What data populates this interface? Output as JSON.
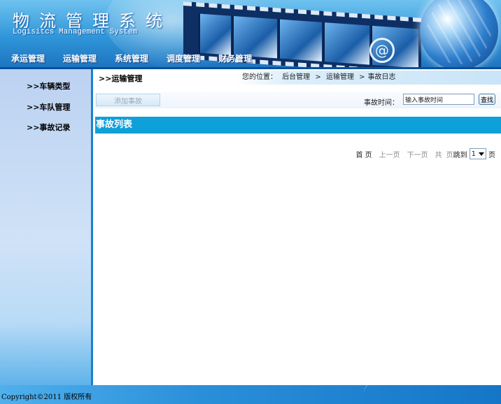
{
  "header": {
    "title": "物流管理系统",
    "subtitle": "Logisitcs Management System"
  },
  "topnav": [
    "承运管理",
    "运输管理",
    "系统管理",
    "调度管理",
    "财务管理"
  ],
  "sidebar": {
    "items": [
      ">>车辆类型",
      ">>车队管理",
      ">>事故记录"
    ]
  },
  "main": {
    "section_title": ">>运输管理",
    "breadcrumb": {
      "prefix": "您的位置：",
      "crumbs": [
        "后台管理",
        "运输管理",
        "事故日志"
      ],
      "separator": ">"
    },
    "toolbar": {
      "add_button": "添加事故",
      "date_label": "事故时间：",
      "date_input_value": "输入事故时间",
      "search_button": "查找"
    },
    "list_title": "事故列表",
    "pager": {
      "first": "首 页",
      "prev": "上一页",
      "next": "下一页",
      "total": "共",
      "pages": "页",
      "jump": "跳到",
      "page_select": "1",
      "page_unit": "页"
    }
  },
  "footer": {
    "copyright": "Copyright©2011 版权所有"
  },
  "colors": {
    "list_header": "#0ea0d8",
    "sidebar_border": "#1a7fcf",
    "footer": "#2a8fd9"
  }
}
